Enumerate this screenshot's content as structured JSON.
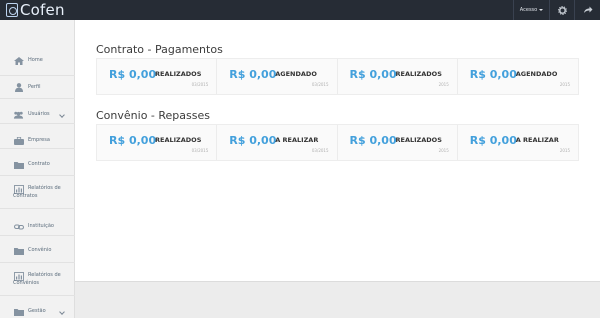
{
  "topbar": {
    "logo_text": "Cofen",
    "acesso_label": "Acesso",
    "bg_color": "#262c35"
  },
  "sidebar": {
    "items": [
      {
        "label": "Home",
        "icon": "home-icon"
      },
      {
        "label": "Perfil",
        "icon": "user-icon"
      },
      {
        "label": "Usuários",
        "icon": "users-icon",
        "expandable": true
      },
      {
        "label": "Empresa",
        "icon": "briefcase-icon"
      },
      {
        "label": "Contrato",
        "icon": "folder-icon"
      },
      {
        "label": "Relatórios de",
        "label2": "Contratos",
        "icon": "chart-icon"
      },
      {
        "label": "Instituição",
        "icon": "link-icon"
      },
      {
        "label": "Convênio",
        "icon": "folder-icon"
      },
      {
        "label": "Relatórios de",
        "label2": "Convênios",
        "icon": "chart-icon"
      },
      {
        "label": "Gestão",
        "icon": "gestao-icon",
        "expandable": true
      }
    ]
  },
  "main": {
    "sections": [
      {
        "title": "Contrato - Pagamentos",
        "cards": [
          {
            "value": "R$ 0,00",
            "status": "REALIZADOS",
            "period": "03/2015"
          },
          {
            "value": "R$ 0,00",
            "status": "AGENDADO",
            "period": "03/2015"
          },
          {
            "value": "R$ 0,00",
            "status": "REALIZADOS",
            "period": "2015"
          },
          {
            "value": "R$ 0,00",
            "status": "AGENDADO",
            "period": "2015"
          }
        ]
      },
      {
        "title": "Convênio - Repasses",
        "cards": [
          {
            "value": "R$ 0,00",
            "status": "REALIZADOS",
            "period": "03/2015"
          },
          {
            "value": "R$ 0,00",
            "status": "A REALIZAR",
            "period": "03/2015"
          },
          {
            "value": "R$ 0,00",
            "status": "REALIZADOS",
            "period": "2015"
          },
          {
            "value": "R$ 0,00",
            "status": "A REALIZAR",
            "period": "2015"
          }
        ]
      }
    ]
  },
  "colors": {
    "accent_value": "#43a0dc"
  }
}
